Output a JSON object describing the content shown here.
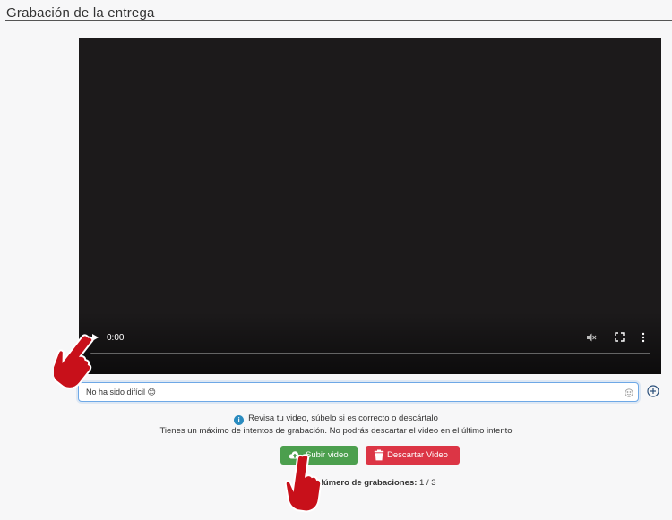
{
  "section": {
    "title": "Grabación de la entrega"
  },
  "video": {
    "time": "0:00",
    "progress": 0
  },
  "comment": {
    "value": "No ha sido difícil 😊"
  },
  "info": {
    "line1": "Revisa tu video, súbelo si es correcto o descártalo",
    "line2": "Tienes un máximo de intentos de grabación. No podrás descartar el video en el último intento"
  },
  "buttons": {
    "upload": "Subir video",
    "discard": "Descartar Video"
  },
  "recordings": {
    "label": "Número de grabaciones:",
    "value": "1 / 3"
  },
  "colors": {
    "upload_button": "#4c9f4e",
    "discard_button": "#dc3545",
    "info_icon": "#2a8bbf",
    "pointer_hand": "#c8101a"
  },
  "icons": {
    "play": "play-icon",
    "mute": "volume-muted-icon",
    "fullscreen": "fullscreen-icon",
    "menu": "more-vertical-icon",
    "emoji": "emoji-icon",
    "add": "plus-circle-icon",
    "info": "info-icon",
    "upload": "cloud-upload-icon",
    "discard": "trash-icon",
    "pointer": "pointing-hand-icon"
  }
}
